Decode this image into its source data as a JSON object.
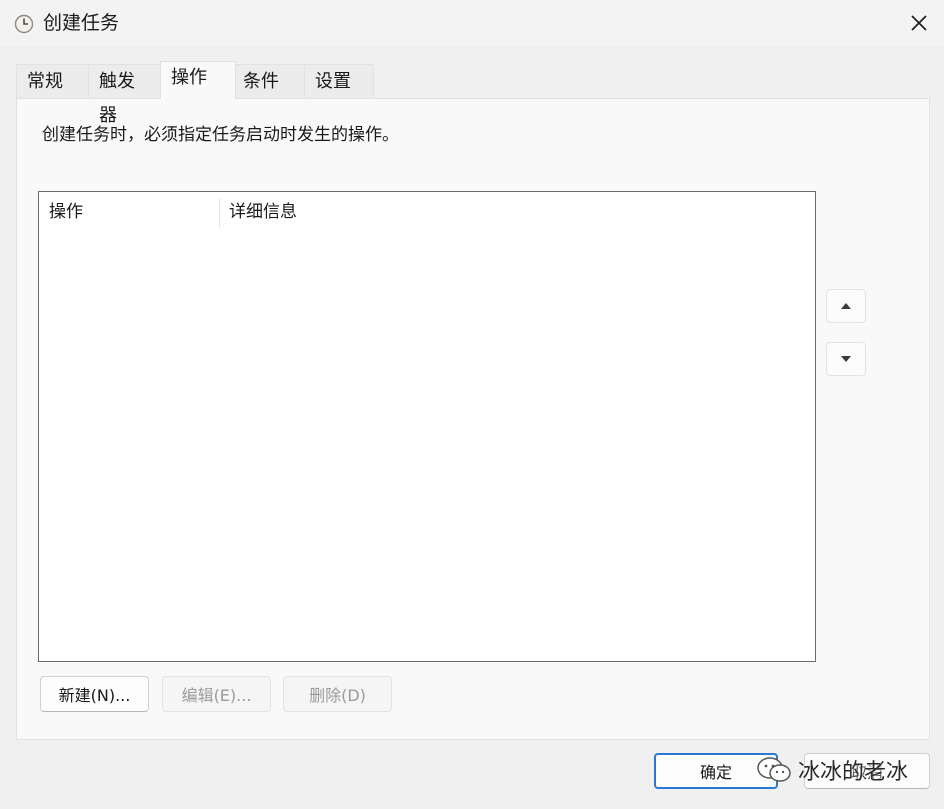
{
  "window": {
    "title": "创建任务"
  },
  "tabs": [
    {
      "label": "常规"
    },
    {
      "label": "触发器"
    },
    {
      "label": "操作"
    },
    {
      "label": "条件"
    },
    {
      "label": "设置"
    }
  ],
  "active_tab": "操作",
  "panel": {
    "description": "创建任务时，必须指定任务启动时发生的操作。",
    "columns": [
      {
        "label": "操作"
      },
      {
        "label": "详细信息"
      }
    ],
    "rows": []
  },
  "buttons": {
    "new": "新建(N)...",
    "edit": "编辑(E)...",
    "delete": "删除(D)",
    "ok": "确定",
    "cancel": "取消"
  },
  "watermark": "冰冰的老冰",
  "icons": {
    "app": "task-scheduler-clock-icon",
    "close": "close-icon",
    "move_up": "move-up-icon",
    "move_down": "move-down-icon",
    "watermark": "wechat-icon"
  },
  "colors": {
    "focus_border": "#2b78d4",
    "disabled_text": "#9a9a9a"
  }
}
